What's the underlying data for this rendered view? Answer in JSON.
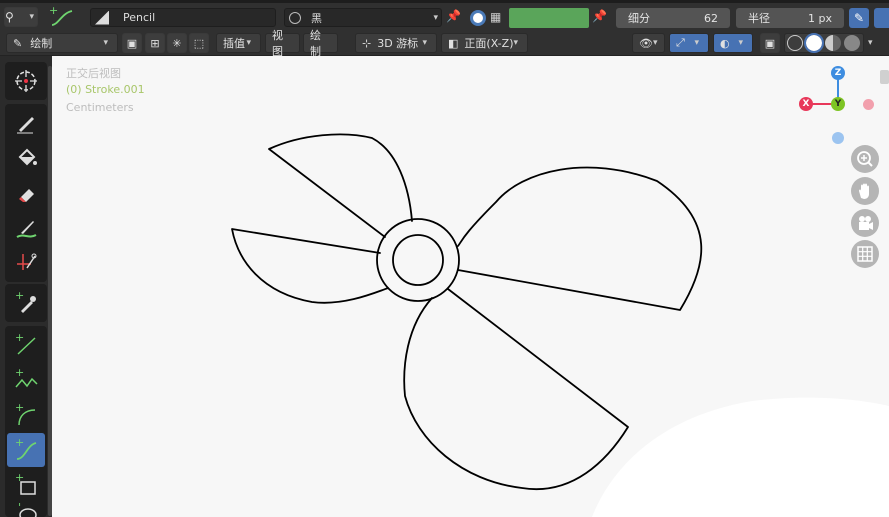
{
  "header": {
    "brush_name": "Pencil",
    "material_name": "黑",
    "subdivision_label": "细分",
    "subdivision_value": "62",
    "radius_label": "半径",
    "radius_value": "1 px",
    "color_swatch": "#5aa55a"
  },
  "toolbar2": {
    "mode": "绘制",
    "interp": "插值",
    "view_btn": "视图",
    "draw_btn": "绘制",
    "cursor": "3D 游标",
    "orientation": "正面(X-Z)"
  },
  "viewport": {
    "view_name": "正交后视图",
    "object_name": "(0) Stroke.001",
    "units": "Centimeters"
  },
  "gizmo": {
    "z": "Z",
    "y": "Y",
    "x": "X"
  },
  "colors": {
    "accent": "#4772b3",
    "stroke": "#000000",
    "x_axis": "#e8385a",
    "y_axis": "#7ec424",
    "z_axis": "#3e8de0"
  }
}
